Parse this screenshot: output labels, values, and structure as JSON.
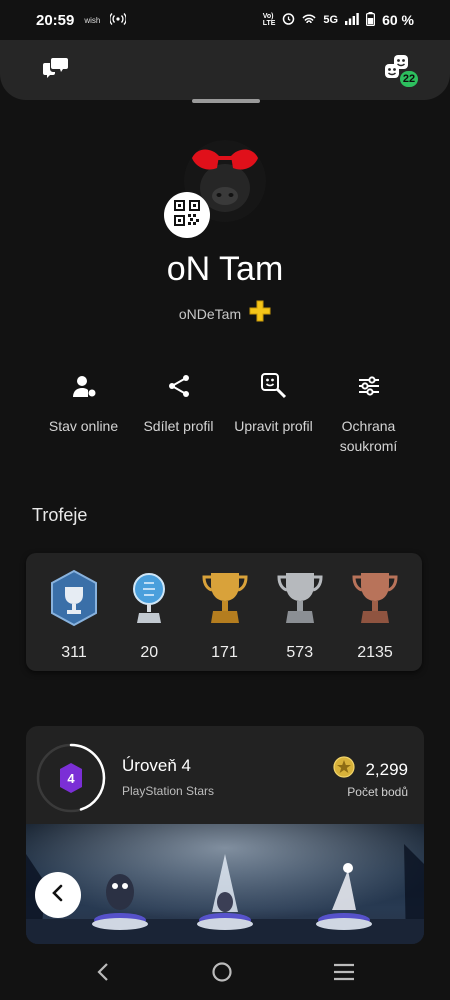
{
  "status_bar": {
    "time": "20:59",
    "carrier": "wish",
    "network": "5G",
    "battery": "60 %"
  },
  "header": {
    "left_icon": "chat-bubbles-icon",
    "right_icon": "friends-icon",
    "friends_badge": "22"
  },
  "profile": {
    "name": "oN Tam",
    "online_id": "oNDeTam",
    "plus_icon": "playstation-plus-icon"
  },
  "actions": [
    {
      "label": "Stav online",
      "icon": "online-status-icon"
    },
    {
      "label": "Sdílet profil",
      "icon": "share-icon"
    },
    {
      "label": "Upravit profil",
      "icon": "edit-profile-icon"
    },
    {
      "label": "Ochrana soukromí",
      "icon": "privacy-sliders-icon"
    }
  ],
  "trophies": {
    "title": "Trofeje",
    "items": [
      {
        "type": "level",
        "count": "311"
      },
      {
        "type": "platinum",
        "count": "20"
      },
      {
        "type": "gold",
        "count": "171"
      },
      {
        "type": "silver",
        "count": "573"
      },
      {
        "type": "bronze",
        "count": "2135"
      }
    ]
  },
  "stars": {
    "level_number": "4",
    "level_label": "Úroveň 4",
    "program": "PlayStation Stars",
    "points": "2,299",
    "points_label": "Počet bodů",
    "level_progress": 0.45
  },
  "colors": {
    "background": "#121212",
    "card": "#232323",
    "badge_green": "#2dbf5e",
    "plus_yellow": "#f5c518",
    "level_purple": "#7b2fd6"
  }
}
